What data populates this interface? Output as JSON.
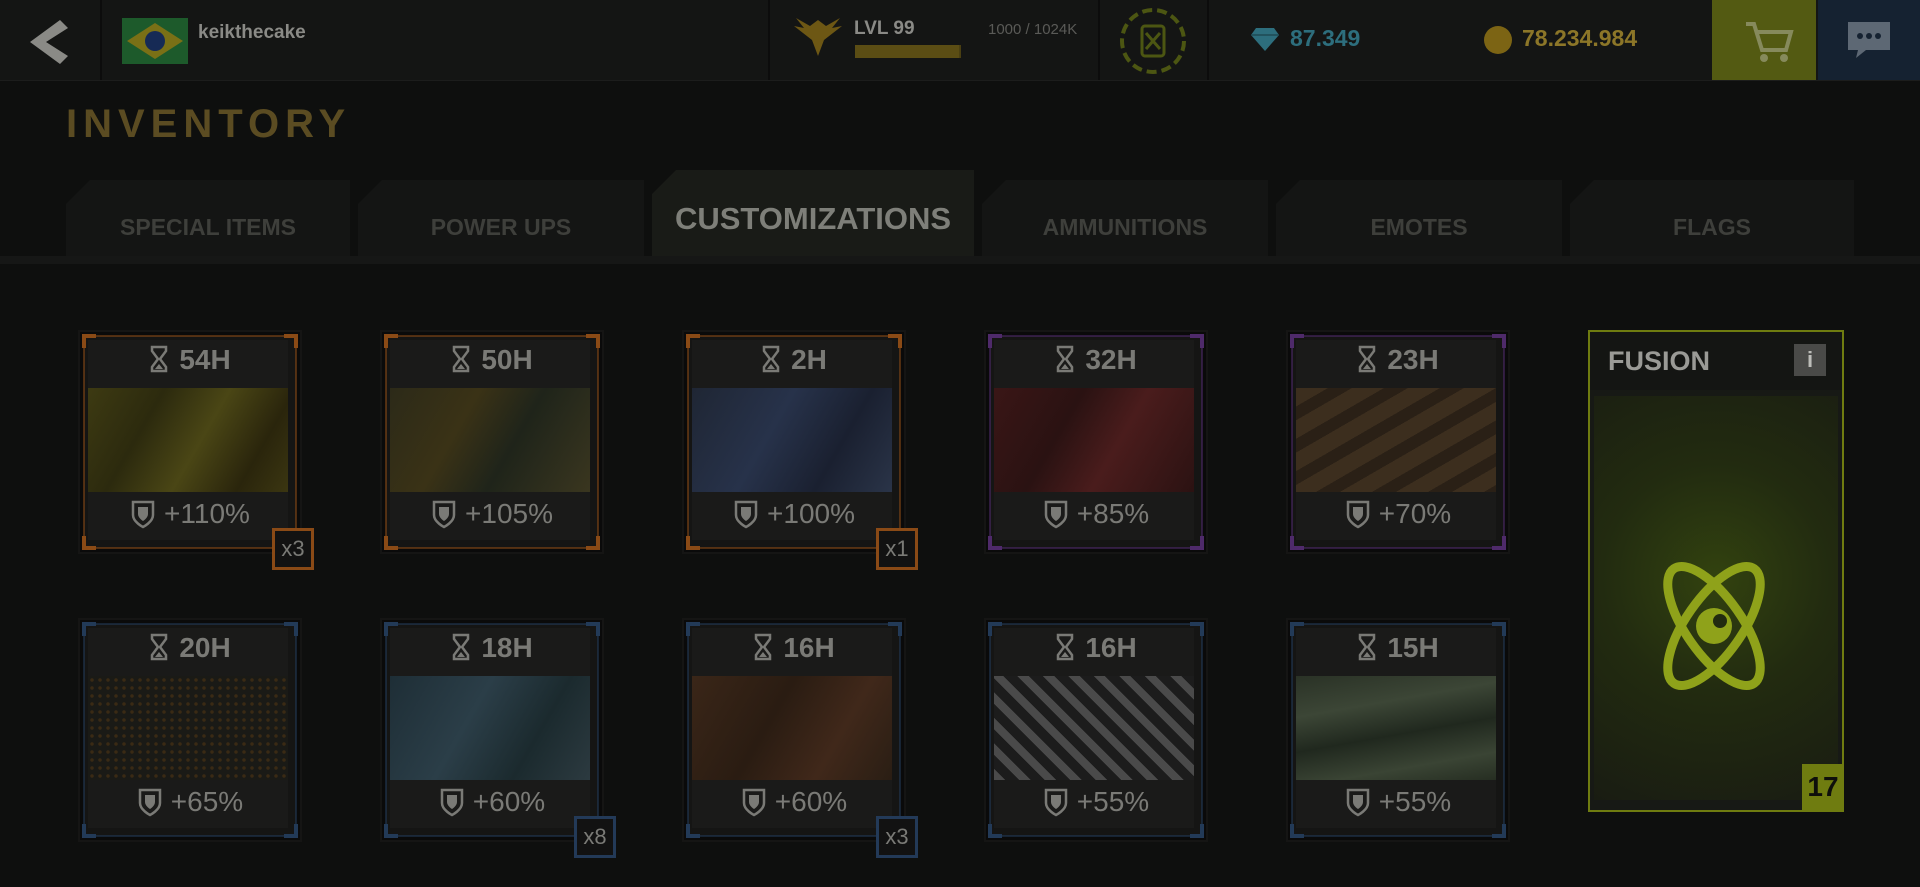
{
  "topbar": {
    "username": "keikthecake",
    "level_label": "LVL 99",
    "xp_text": "1000 / 1024K",
    "xp_fraction": 0.98,
    "gems": "87.349",
    "coins": "78.234.984"
  },
  "page_title": "INVENTORY",
  "tabs": [
    {
      "label": "SPECIAL ITEMS"
    },
    {
      "label": "POWER UPS"
    },
    {
      "label": "CUSTOMIZATIONS"
    },
    {
      "label": "AMMUNITIONS"
    },
    {
      "label": "EMOTES"
    },
    {
      "label": "FLAGS"
    }
  ],
  "active_tab": "CUSTOMIZATIONS",
  "items": [
    {
      "timer": "54H",
      "bonus": "+110%",
      "qty": "x3",
      "rarity": "orange"
    },
    {
      "timer": "50H",
      "bonus": "+105%",
      "qty": "",
      "rarity": "orange"
    },
    {
      "timer": "2H",
      "bonus": "+100%",
      "qty": "x1",
      "rarity": "orange"
    },
    {
      "timer": "32H",
      "bonus": "+85%",
      "qty": "",
      "rarity": "purple"
    },
    {
      "timer": "23H",
      "bonus": "+70%",
      "qty": "",
      "rarity": "purple"
    },
    {
      "timer": "20H",
      "bonus": "+65%",
      "qty": "",
      "rarity": "blue"
    },
    {
      "timer": "18H",
      "bonus": "+60%",
      "qty": "x8",
      "rarity": "blue"
    },
    {
      "timer": "16H",
      "bonus": "+60%",
      "qty": "x3",
      "rarity": "blue"
    },
    {
      "timer": "16H",
      "bonus": "+55%",
      "qty": "",
      "rarity": "blue"
    },
    {
      "timer": "15H",
      "bonus": "+55%",
      "qty": "",
      "rarity": "blue"
    }
  ],
  "fusion": {
    "title": "FUSION",
    "info_label": "i",
    "count": "17"
  },
  "colors": {
    "orange": "#8a4a16",
    "purple": "#4f2a6a",
    "blue": "#233a58",
    "fusion_accent": "#c6e31e",
    "gems": "#2d6e7d",
    "coins": "#8c7628"
  },
  "icons": [
    "back-arrow-icon",
    "brazil-flag-icon",
    "rank-eagle-icon",
    "fuel-can-icon",
    "gem-icon",
    "coin-icon",
    "cart-icon",
    "chat-icon",
    "hourglass-icon",
    "shield-icon",
    "info-icon",
    "atom-icon"
  ]
}
